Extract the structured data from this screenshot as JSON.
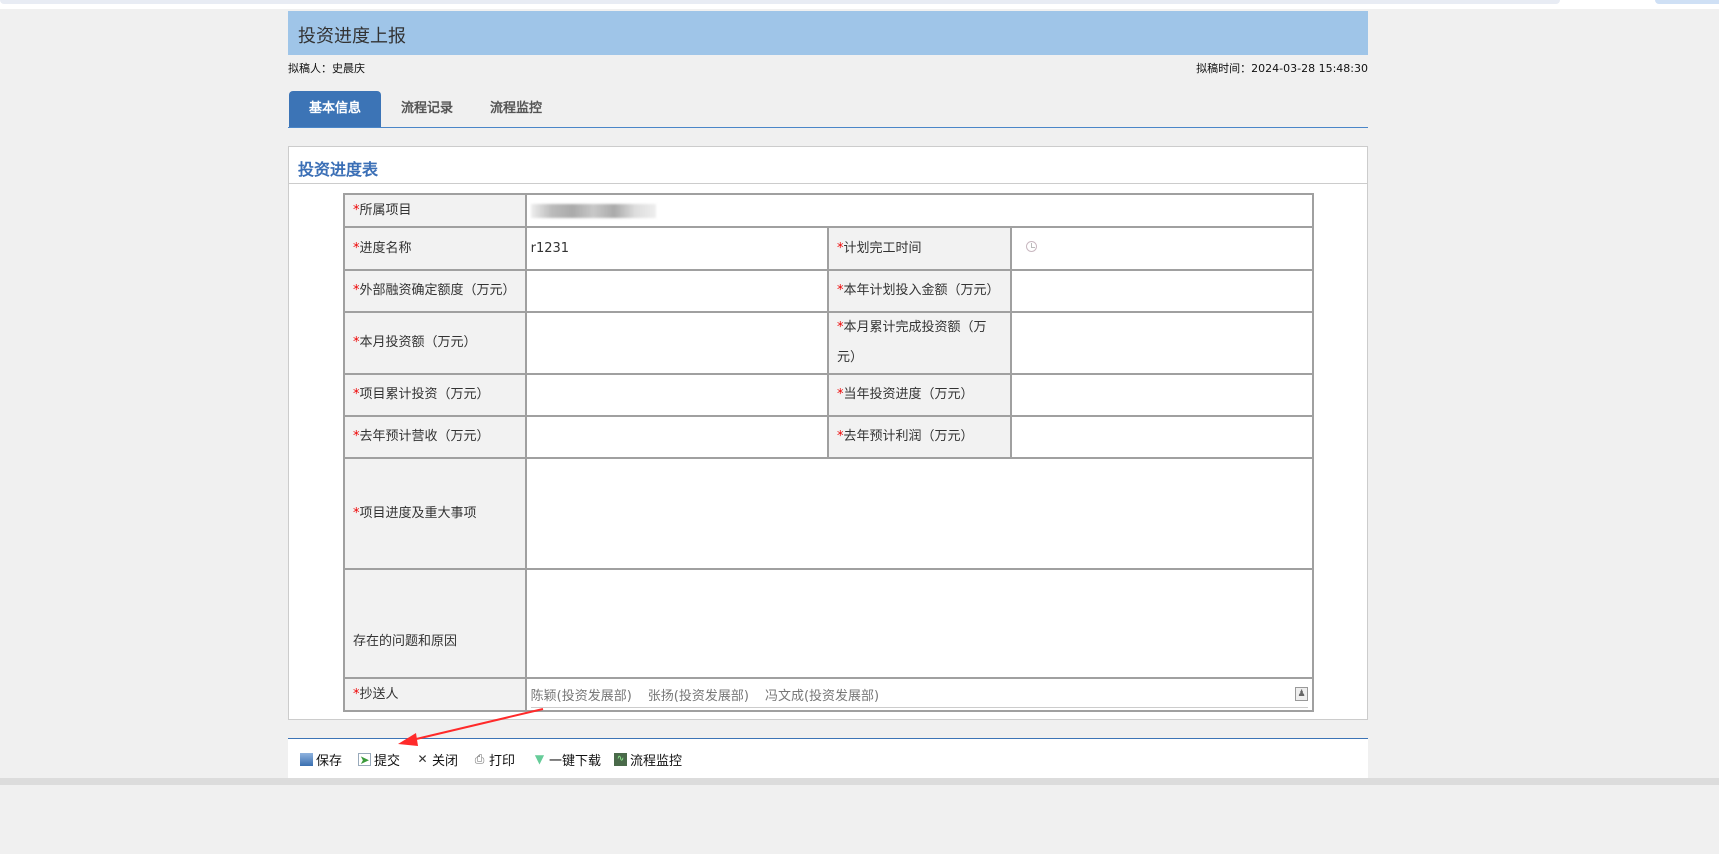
{
  "header": {
    "title": "投资进度上报"
  },
  "meta": {
    "drafter": "拟稿人：史晨庆",
    "draft_time": "拟稿时间：2024-03-28 15:48:30"
  },
  "tabs": [
    {
      "label": "基本信息"
    },
    {
      "label": "流程记录"
    },
    {
      "label": "流程监控"
    }
  ],
  "panel": {
    "title": "投资进度表"
  },
  "form": {
    "required_mark": "*",
    "project_label": "所属项目",
    "progress_name_label": "进度名称",
    "progress_name_value": "r1231",
    "planned_completion_label": "计划完工时间",
    "external_financing_label": "外部融资确定额度（万元）",
    "annual_planned_label": "本年计划投入金额（万元）",
    "monthly_investment_label": "本月投资额（万元）",
    "monthly_cumulative_label": "本月累计完成投资额（万元）",
    "project_cumulative_label": "项目累计投资（万元）",
    "annual_progress_label": "当年投资进度（万元）",
    "last_year_revenue_label": "去年预计营收（万元）",
    "last_year_profit_label": "去年预计利润（万元）",
    "major_events_label": "项目进度及重大事项",
    "problems_label": "存在的问题和原因",
    "cc_label": "抄送人",
    "cc_people": [
      "陈颖(投资发展部)",
      "张扬(投资发展部)",
      "冯文成(投资发展部)"
    ]
  },
  "toolbar": {
    "save": "保存",
    "submit": "提交",
    "close": "关闭",
    "print": "打印",
    "download": "一键下载",
    "monitor": "流程监控"
  },
  "colors": {
    "header": "#9fc5e8",
    "accent": "#3c74b6",
    "required": "#ee0000",
    "annotation": "#ff2a2a"
  }
}
